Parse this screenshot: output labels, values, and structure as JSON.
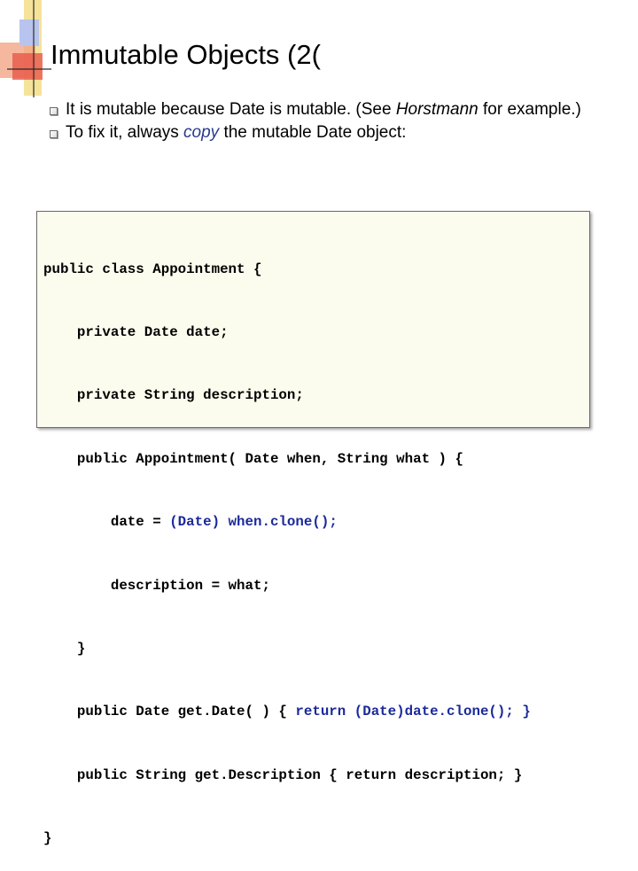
{
  "slide": {
    "title": "Immutable Objects (2(",
    "bullets": [
      {
        "parts": [
          {
            "text": "It is mutable because Date is mutable. (See ",
            "style": "normal"
          },
          {
            "text": "Horstmann",
            "style": "italic"
          },
          {
            "text": " for example.)",
            "style": "normal"
          }
        ]
      },
      {
        "parts": [
          {
            "text": "To fix it, always ",
            "style": "normal"
          },
          {
            "text": "copy",
            "style": "copy"
          },
          {
            "text": " the mutable Date object:",
            "style": "normal"
          }
        ]
      }
    ],
    "code": [
      [
        {
          "t": "public class Appointment {"
        }
      ],
      [
        {
          "t": "    private Date date;"
        }
      ],
      [
        {
          "t": "    private String description;"
        }
      ],
      [
        {
          "t": "    public Appointment( Date when, String what ) {"
        }
      ],
      [
        {
          "t": "        date = "
        },
        {
          "t": "(Date) when.clone();",
          "hl": true
        }
      ],
      [
        {
          "t": "        description = what;"
        }
      ],
      [
        {
          "t": "    }"
        }
      ],
      [
        {
          "t": "    public Date get.Date( ) { "
        },
        {
          "t": "return (Date)date.clone(); }",
          "hl": true
        }
      ],
      [
        {
          "t": "    public String get.Description { return description; }"
        }
      ],
      [
        {
          "t": "}"
        }
      ]
    ],
    "colors": {
      "code_highlight": "#1b2a9a",
      "code_background": "#fcfcee",
      "emphasis": "#2a3b8f",
      "corner_red": "#e8574a",
      "corner_yellow": "#f3cf55",
      "corner_blue": "#6e86d8"
    }
  }
}
